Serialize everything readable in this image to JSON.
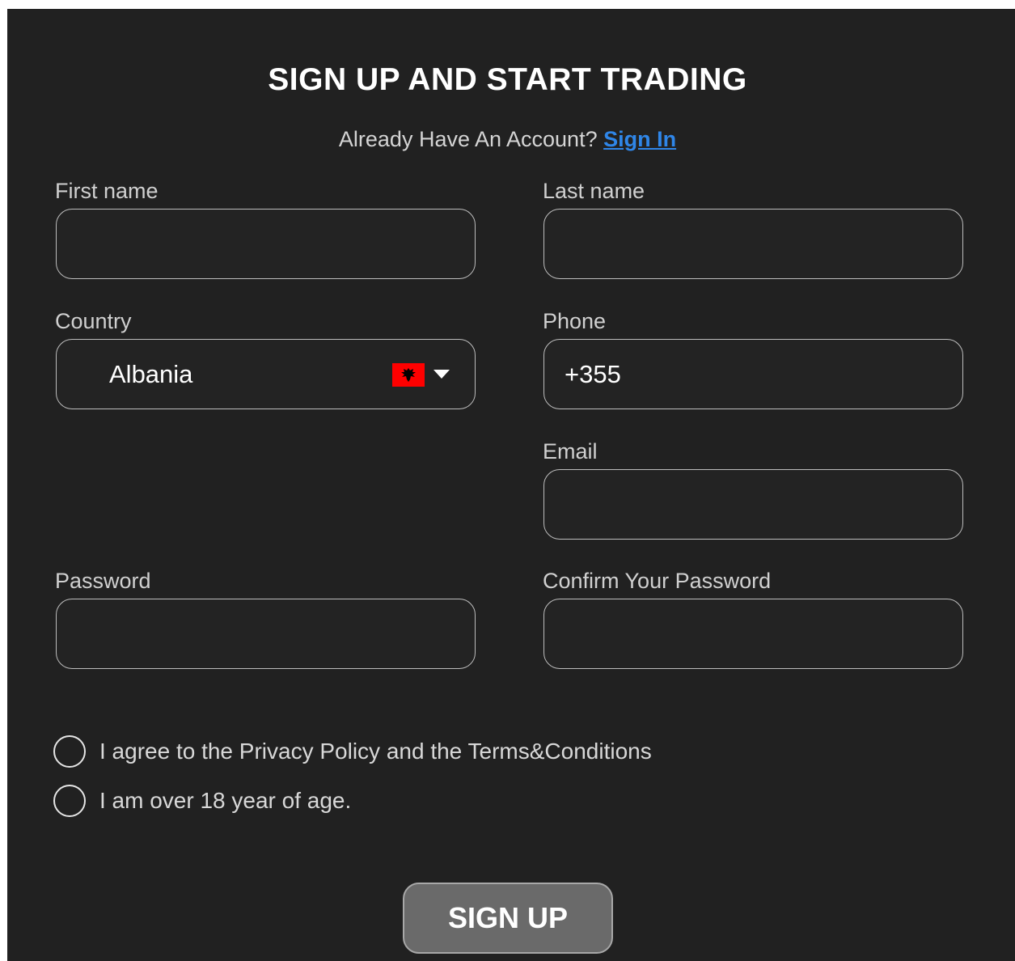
{
  "form": {
    "title": "SIGN UP AND START TRADING",
    "account_prompt": "Already Have An Account?",
    "sign_in_link": "Sign In",
    "first_name": {
      "label": "First name",
      "value": ""
    },
    "last_name": {
      "label": "Last name",
      "value": ""
    },
    "country": {
      "label": "Country",
      "value": "Albania",
      "flag_icon": "albania-flag-icon",
      "flag_color": "#ff0000"
    },
    "phone": {
      "label": "Phone",
      "value": "+355"
    },
    "email": {
      "label": "Email",
      "value": ""
    },
    "password": {
      "label": "Password",
      "value": ""
    },
    "confirm_password": {
      "label": "Confirm Your Password",
      "value": ""
    },
    "agree_privacy": {
      "label": "I agree to the Privacy Policy and the Terms&Conditions",
      "checked": false
    },
    "age_confirm": {
      "label": "I am over 18 year of age.",
      "checked": false
    },
    "submit_label": "SIGN UP"
  },
  "colors": {
    "background": "#212121",
    "link": "#2f86e8",
    "button": "#6a6a6a"
  }
}
